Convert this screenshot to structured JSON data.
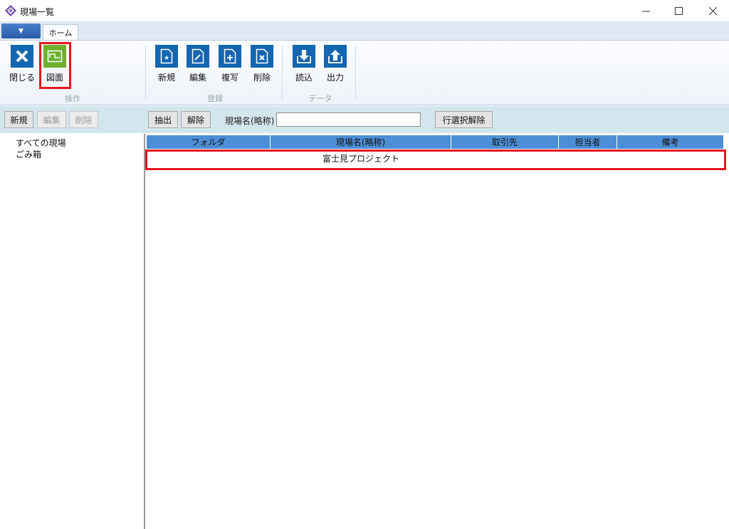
{
  "window": {
    "title": "現場一覧",
    "minimize_icon": "minimize-icon",
    "maximize_icon": "maximize-icon",
    "close_icon": "close-icon"
  },
  "ribbon": {
    "tabs": [
      {
        "label": "ホーム",
        "active": true
      }
    ],
    "groups": [
      {
        "label": "操作",
        "buttons": [
          {
            "label": "閉じる",
            "icon": "close-x-icon",
            "color": "#1566b0"
          },
          {
            "label": "図面",
            "icon": "drawing-icon",
            "color": "#6cb02d",
            "highlighted": true
          }
        ]
      },
      {
        "label": "登録",
        "buttons": [
          {
            "label": "新規",
            "icon": "new-document-icon",
            "color": "#1566b0"
          },
          {
            "label": "編集",
            "icon": "edit-document-icon",
            "color": "#1566b0"
          },
          {
            "label": "複写",
            "icon": "copy-document-icon",
            "color": "#1566b0"
          },
          {
            "label": "削除",
            "icon": "delete-document-icon",
            "color": "#1566b0"
          }
        ]
      },
      {
        "label": "データ",
        "buttons": [
          {
            "label": "読込",
            "icon": "import-icon",
            "color": "#1566b0"
          },
          {
            "label": "出力",
            "icon": "export-icon",
            "color": "#1566b0"
          }
        ]
      }
    ]
  },
  "left_toolbar": {
    "new": "新規",
    "edit": "編集",
    "delete": "削除"
  },
  "filter_bar": {
    "extract": "抽出",
    "clear": "解除",
    "site_name_label": "現場名(略称)",
    "site_name_value": "",
    "deselect_row": "行選択解除"
  },
  "tree": {
    "items": [
      "すべての現場",
      "ごみ箱"
    ]
  },
  "grid": {
    "columns": [
      "フォルダ",
      "現場名(略称)",
      "取引先",
      "担当者",
      "備考"
    ],
    "rows": [
      {
        "folder": "",
        "site_name": "富士見プロジェクト",
        "client": "",
        "person": "",
        "notes": "",
        "highlighted": true
      }
    ]
  },
  "colors": {
    "highlight": "#e4151f",
    "grid_header": "#4d8fd6",
    "toolbar_bg": "#d3e6ee",
    "ribbon_blue": "#1566b0",
    "ribbon_green": "#6cb02d"
  }
}
